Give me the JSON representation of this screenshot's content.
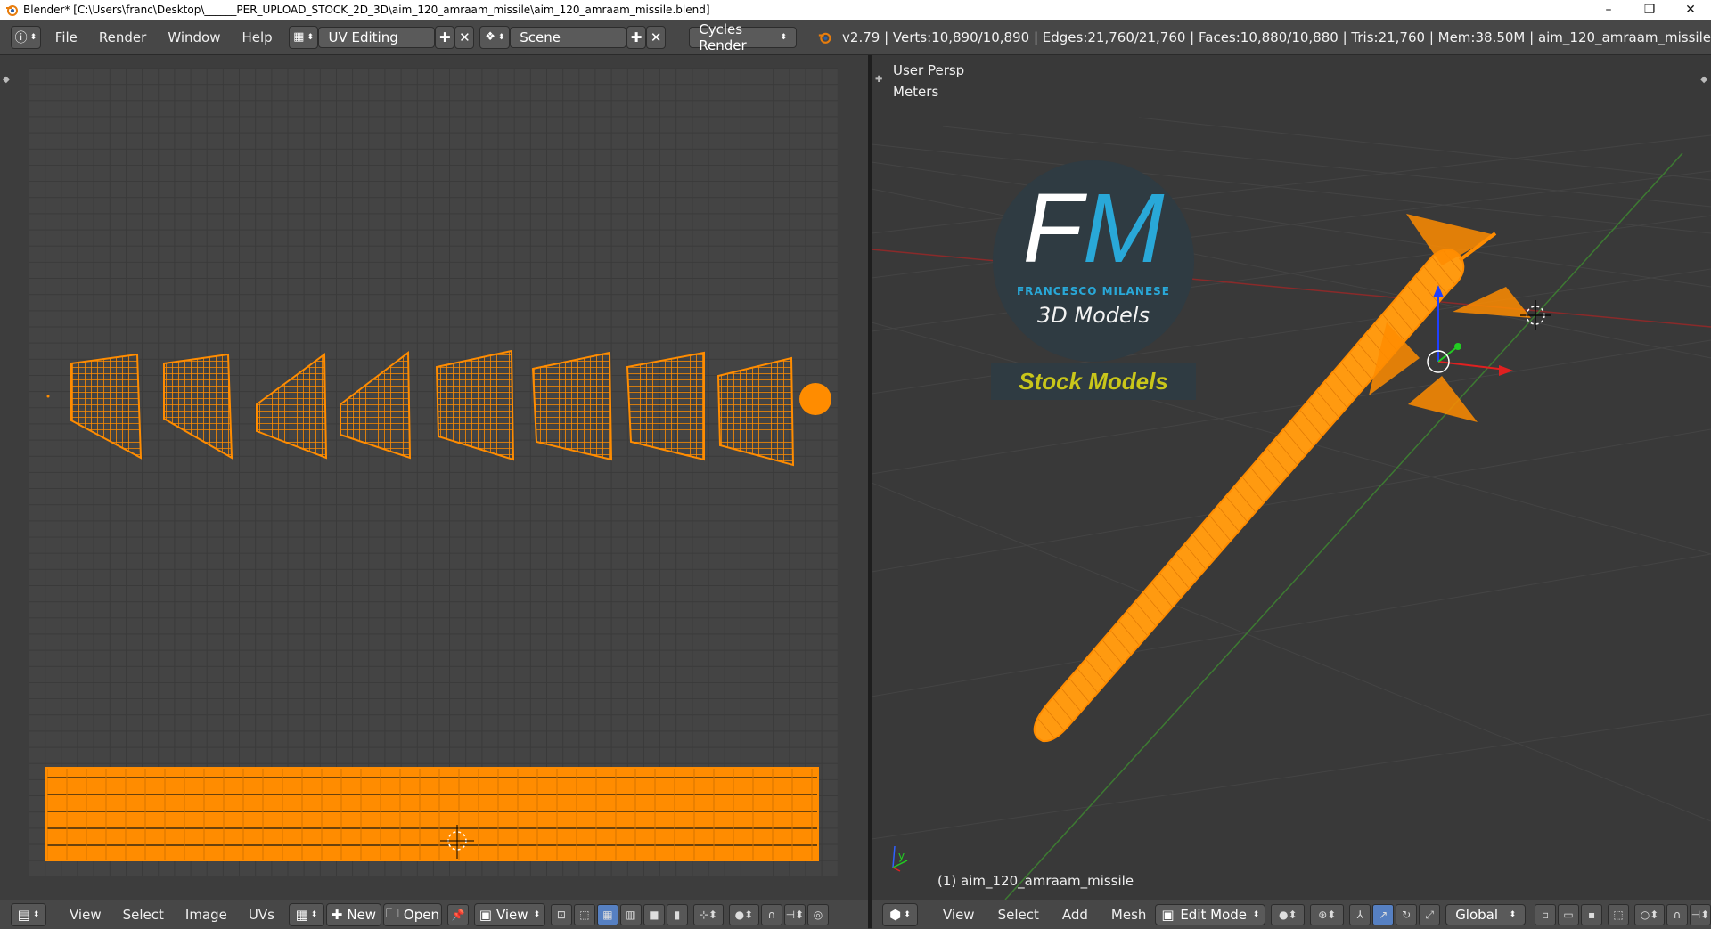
{
  "window": {
    "title": "Blender* [C:\\Users\\franc\\Desktop\\______PER_UPLOAD_STOCK_2D_3D\\aim_120_amraam_missile\\aim_120_amraam_missile.blend]",
    "controls": [
      "–",
      "❐",
      "✕"
    ]
  },
  "header": {
    "menus": [
      "File",
      "Render",
      "Window",
      "Help"
    ],
    "screen_layout": "UV Editing",
    "scene": "Scene",
    "render_engine": "Cycles Render",
    "stats": "v2.79 | Verts:10,890/10,890 | Edges:21,760/21,760 | Faces:10,880/10,880 | Tris:21,760 | Mem:38.50M | aim_120_amraam_missile"
  },
  "uv_editor": {
    "footer_menus": [
      "View",
      "Select",
      "Image",
      "UVs"
    ],
    "new_label": "New",
    "open_label": "Open",
    "view_label": "View"
  },
  "viewport": {
    "view_name": "User Persp",
    "units": "Meters",
    "object_label": "(1) aim_120_amraam_missile",
    "footer_menus": [
      "View",
      "Select",
      "Add",
      "Mesh"
    ],
    "mode": "Edit Mode",
    "orientation": "Global",
    "axis_y": "y",
    "axis_x": "x"
  },
  "watermark": {
    "logo_letters": "FM",
    "author": "FRANCESCO MILANESE",
    "subtitle": "3D Models",
    "banner": "Stock Models"
  },
  "colors": {
    "mesh_orange": "#ff8c00",
    "accent_blue": "#5680c2",
    "logo_bg": "#2f3b42",
    "logo_cyan": "#29a8d8",
    "banner_yellow": "#c9c61a"
  }
}
